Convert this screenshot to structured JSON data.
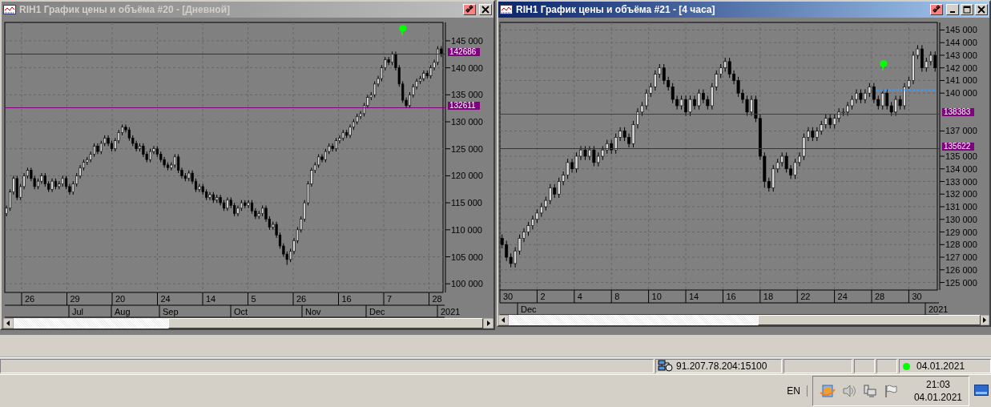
{
  "windows": [
    {
      "title": "RIH1 График цены и объёма #20 - [Дневной]",
      "active": false,
      "title_buttons": [
        {
          "kind": "link"
        },
        {
          "kind": "close"
        }
      ],
      "chart_data": {
        "type": "candlestick",
        "grid": true,
        "ylim": [
          98400,
          148400
        ],
        "yticks": [
          {
            "value": 145000,
            "label": "145 000"
          },
          {
            "value": 140000,
            "label": "140 000"
          },
          {
            "value": 135000,
            "label": "135 000"
          },
          {
            "value": 130000,
            "label": "130 000"
          },
          {
            "value": 125000,
            "label": "125 000"
          },
          {
            "value": 120000,
            "label": "120 000"
          },
          {
            "value": 115000,
            "label": "115 000"
          },
          {
            "value": 110000,
            "label": "110 000"
          },
          {
            "value": 105000,
            "label": "105 000"
          },
          {
            "value": 100000,
            "label": "100 000"
          }
        ],
        "ohlc": [
          [
            113000,
            114500,
            112500,
            114000
          ],
          [
            114000,
            117500,
            113500,
            117000
          ],
          [
            117000,
            120000,
            116500,
            119500
          ],
          [
            119500,
            120000,
            115500,
            116000
          ],
          [
            116000,
            118500,
            115500,
            118000
          ],
          [
            118000,
            120500,
            117500,
            120000
          ],
          [
            120000,
            121500,
            119500,
            121000
          ],
          [
            121000,
            121500,
            119000,
            119500
          ],
          [
            119500,
            120000,
            117500,
            118000
          ],
          [
            118000,
            119500,
            117500,
            119000
          ],
          [
            119000,
            120500,
            118500,
            120000
          ],
          [
            120000,
            120500,
            118000,
            118500
          ],
          [
            118500,
            119000,
            117000,
            117500
          ],
          [
            117500,
            119500,
            117000,
            119000
          ],
          [
            119000,
            119500,
            117500,
            118000
          ],
          [
            118000,
            119000,
            117500,
            118500
          ],
          [
            118500,
            120000,
            118000,
            119500
          ],
          [
            119500,
            120000,
            117500,
            118000
          ],
          [
            118000,
            118500,
            116500,
            117000
          ],
          [
            117000,
            119000,
            116500,
            118500
          ],
          [
            118500,
            120500,
            118000,
            120000
          ],
          [
            120000,
            122000,
            119500,
            121500
          ],
          [
            121500,
            123000,
            121000,
            122500
          ],
          [
            122500,
            123500,
            122000,
            123000
          ],
          [
            123000,
            124500,
            122500,
            124000
          ],
          [
            124000,
            126000,
            123500,
            125500
          ],
          [
            125500,
            126000,
            124000,
            124500
          ],
          [
            124500,
            126500,
            124000,
            126000
          ],
          [
            126000,
            127500,
            125500,
            127000
          ],
          [
            127000,
            127500,
            125500,
            126000
          ],
          [
            126000,
            126500,
            124500,
            125000
          ],
          [
            125000,
            127000,
            124500,
            126500
          ],
          [
            126500,
            128500,
            126000,
            128000
          ],
          [
            128000,
            129500,
            127500,
            129000
          ],
          [
            129000,
            129500,
            128000,
            128500
          ],
          [
            128500,
            129000,
            126500,
            127000
          ],
          [
            127000,
            127500,
            125500,
            126000
          ],
          [
            126000,
            126500,
            124500,
            125000
          ],
          [
            125000,
            126000,
            124500,
            125500
          ],
          [
            125500,
            126000,
            123500,
            124000
          ],
          [
            124000,
            124500,
            122500,
            123000
          ],
          [
            123000,
            125000,
            122500,
            124500
          ],
          [
            124500,
            125500,
            124000,
            125000
          ],
          [
            125000,
            125500,
            123500,
            124000
          ],
          [
            124000,
            124500,
            122500,
            123000
          ],
          [
            123000,
            123500,
            121500,
            122000
          ],
          [
            122000,
            122500,
            121000,
            121500
          ],
          [
            121500,
            122500,
            121000,
            122000
          ],
          [
            122000,
            124000,
            121500,
            123500
          ],
          [
            123500,
            124000,
            120500,
            121000
          ],
          [
            121000,
            121500,
            119500,
            120000
          ],
          [
            120000,
            120500,
            119000,
            119500
          ],
          [
            119500,
            121000,
            119000,
            120500
          ],
          [
            120500,
            121000,
            118500,
            119000
          ],
          [
            119000,
            119500,
            117000,
            117500
          ],
          [
            117500,
            118500,
            117000,
            118000
          ],
          [
            118000,
            118500,
            116500,
            117000
          ],
          [
            117000,
            117500,
            115500,
            116000
          ],
          [
            116000,
            117000,
            115500,
            116500
          ],
          [
            116500,
            117000,
            115000,
            115500
          ],
          [
            115500,
            116500,
            115000,
            116000
          ],
          [
            116000,
            116500,
            114500,
            115000
          ],
          [
            115000,
            115500,
            113500,
            114000
          ],
          [
            114000,
            116000,
            113500,
            115500
          ],
          [
            115500,
            116000,
            114000,
            114500
          ],
          [
            114500,
            115000,
            112500,
            113000
          ],
          [
            113000,
            114500,
            112500,
            114000
          ],
          [
            114000,
            115500,
            113500,
            115000
          ],
          [
            115000,
            115500,
            114000,
            114500
          ],
          [
            114500,
            115500,
            114000,
            115000
          ],
          [
            115000,
            115500,
            113000,
            113500
          ],
          [
            113500,
            114000,
            112000,
            112500
          ],
          [
            112500,
            113500,
            112000,
            113000
          ],
          [
            113000,
            114500,
            112500,
            114000
          ],
          [
            114000,
            114500,
            111500,
            112000
          ],
          [
            112000,
            112500,
            110000,
            110500
          ],
          [
            110500,
            111500,
            110000,
            111000
          ],
          [
            111000,
            111500,
            108500,
            109000
          ],
          [
            109000,
            109500,
            106500,
            107000
          ],
          [
            107000,
            107500,
            105000,
            105500
          ],
          [
            105500,
            106000,
            103500,
            104500
          ],
          [
            104500,
            106500,
            104000,
            106000
          ],
          [
            106000,
            108500,
            105500,
            108000
          ],
          [
            108000,
            110500,
            107500,
            110000
          ],
          [
            110000,
            112500,
            109500,
            112000
          ],
          [
            112000,
            115500,
            111500,
            115000
          ],
          [
            115000,
            119000,
            114500,
            118500
          ],
          [
            118500,
            121500,
            118000,
            121000
          ],
          [
            121000,
            122500,
            120500,
            122000
          ],
          [
            122000,
            124000,
            121500,
            123500
          ],
          [
            123500,
            124000,
            122500,
            123000
          ],
          [
            123000,
            125000,
            122500,
            124500
          ],
          [
            124500,
            126000,
            124000,
            125500
          ],
          [
            125500,
            126000,
            124500,
            125000
          ],
          [
            125000,
            127000,
            124500,
            126500
          ],
          [
            126500,
            127500,
            126000,
            127000
          ],
          [
            127000,
            128500,
            126500,
            128000
          ],
          [
            128000,
            128500,
            127000,
            127500
          ],
          [
            127500,
            129500,
            127000,
            129000
          ],
          [
            129000,
            130500,
            128500,
            130000
          ],
          [
            130000,
            131500,
            129500,
            131000
          ],
          [
            131000,
            132000,
            130500,
            131500
          ],
          [
            131500,
            133500,
            131000,
            133000
          ],
          [
            133000,
            135000,
            132500,
            134500
          ],
          [
            134500,
            135500,
            134000,
            135000
          ],
          [
            135000,
            137500,
            134500,
            137000
          ],
          [
            137000,
            138500,
            136500,
            138000
          ],
          [
            138000,
            140500,
            137500,
            140000
          ],
          [
            140000,
            142000,
            139500,
            141500
          ],
          [
            141500,
            142000,
            140500,
            141000
          ],
          [
            141000,
            143000,
            140500,
            142500
          ],
          [
            142500,
            143000,
            139500,
            140000
          ],
          [
            140000,
            140500,
            136500,
            137000
          ],
          [
            137000,
            137500,
            133500,
            134000
          ],
          [
            134000,
            134500,
            132500,
            133000
          ],
          [
            133000,
            135500,
            132500,
            135000
          ],
          [
            135000,
            137000,
            134500,
            136500
          ],
          [
            136500,
            138000,
            136000,
            137500
          ],
          [
            137500,
            138500,
            137000,
            138000
          ],
          [
            138000,
            139500,
            137500,
            139000
          ],
          [
            139000,
            139500,
            138000,
            138500
          ],
          [
            138500,
            140500,
            138000,
            140000
          ],
          [
            140000,
            141500,
            139500,
            141000
          ],
          [
            141000,
            144000,
            140500,
            143500
          ],
          [
            143500,
            144000,
            142000,
            142500
          ]
        ]
      },
      "levels": [
        {
          "tag": "142686",
          "color": "#800080"
        },
        {
          "tag": "132611",
          "color": "#800080"
        }
      ],
      "signal_marker": true,
      "day_labels": [
        "26",
        "29",
        "20",
        "24",
        "14",
        "5",
        "26",
        "16",
        "7",
        "28"
      ],
      "month_labels": [
        "Jul",
        "Aug",
        "Sep",
        "Oct",
        "Nov",
        "Dec",
        "2021"
      ]
    },
    {
      "title": "RIH1 График цены и объёма #21 - [4 часа]",
      "active": true,
      "title_buttons": [
        {
          "kind": "link"
        },
        {
          "kind": "minimize"
        },
        {
          "kind": "maximize"
        },
        {
          "kind": "close"
        }
      ],
      "chart_data": {
        "type": "candlestick",
        "grid": true,
        "ylim": [
          124400,
          145600
        ],
        "yticks": [
          {
            "value": 145000,
            "label": "145 000"
          },
          {
            "value": 144000,
            "label": "144 000"
          },
          {
            "value": 143000,
            "label": "143 000"
          },
          {
            "value": 142000,
            "label": "142 000"
          },
          {
            "value": 141000,
            "label": "141 000"
          },
          {
            "value": 140000,
            "label": "140 000"
          },
          {
            "value": 137000,
            "label": "137 000"
          },
          {
            "value": 135000,
            "label": "135 000"
          },
          {
            "value": 134000,
            "label": "134 000"
          },
          {
            "value": 133000,
            "label": "133 000"
          },
          {
            "value": 132000,
            "label": "132 000"
          },
          {
            "value": 131000,
            "label": "131 000"
          },
          {
            "value": 130000,
            "label": "130 000"
          },
          {
            "value": 129000,
            "label": "129 000"
          },
          {
            "value": 128000,
            "label": "128 000"
          },
          {
            "value": 127000,
            "label": "127 000"
          },
          {
            "value": 126000,
            "label": "126 000"
          },
          {
            "value": 125000,
            "label": "125 000"
          }
        ],
        "ohlc": [
          [
            128500,
            128800,
            127700,
            128000
          ],
          [
            128000,
            128300,
            126700,
            127000
          ],
          [
            127000,
            127300,
            126200,
            126500
          ],
          [
            126500,
            127800,
            126200,
            127500
          ],
          [
            127500,
            128800,
            127200,
            128500
          ],
          [
            128500,
            129300,
            128200,
            129000
          ],
          [
            129000,
            129800,
            128700,
            129500
          ],
          [
            129500,
            130300,
            129200,
            130000
          ],
          [
            130000,
            130800,
            129700,
            130500
          ],
          [
            130500,
            131300,
            130200,
            131000
          ],
          [
            131000,
            131800,
            130700,
            131500
          ],
          [
            131500,
            132800,
            131200,
            132500
          ],
          [
            132500,
            132800,
            131700,
            132000
          ],
          [
            132000,
            133300,
            131700,
            133000
          ],
          [
            133000,
            133800,
            132700,
            133500
          ],
          [
            133500,
            134800,
            133200,
            134500
          ],
          [
            134500,
            134800,
            133700,
            134000
          ],
          [
            134000,
            135300,
            133700,
            135000
          ],
          [
            135000,
            135800,
            134700,
            135500
          ],
          [
            135500,
            135800,
            134700,
            135000
          ],
          [
            135000,
            135800,
            134700,
            135500
          ],
          [
            135500,
            135800,
            134200,
            134500
          ],
          [
            134500,
            135300,
            134200,
            135000
          ],
          [
            135000,
            135800,
            134700,
            135500
          ],
          [
            135500,
            136300,
            135200,
            136000
          ],
          [
            136000,
            136300,
            135200,
            135500
          ],
          [
            135500,
            136800,
            135200,
            136500
          ],
          [
            136500,
            137300,
            136200,
            137000
          ],
          [
            137000,
            137300,
            136200,
            136500
          ],
          [
            136500,
            136800,
            135700,
            136000
          ],
          [
            136000,
            137800,
            135700,
            137500
          ],
          [
            137500,
            138800,
            137200,
            138500
          ],
          [
            138500,
            139300,
            138200,
            139000
          ],
          [
            139000,
            140300,
            138700,
            140000
          ],
          [
            140000,
            140800,
            139700,
            140500
          ],
          [
            140500,
            141800,
            140200,
            141500
          ],
          [
            141500,
            142300,
            141200,
            142000
          ],
          [
            142000,
            142300,
            140700,
            141000
          ],
          [
            141000,
            141300,
            140200,
            140500
          ],
          [
            140500,
            140800,
            139200,
            139500
          ],
          [
            139500,
            139800,
            138700,
            139000
          ],
          [
            139000,
            139800,
            138700,
            139500
          ],
          [
            139500,
            139800,
            138200,
            138500
          ],
          [
            138500,
            139800,
            138200,
            139500
          ],
          [
            139500,
            139800,
            138700,
            139000
          ],
          [
            139000,
            140300,
            138700,
            140000
          ],
          [
            140000,
            140300,
            139200,
            139500
          ],
          [
            139500,
            139800,
            138700,
            139000
          ],
          [
            139000,
            140800,
            138700,
            140500
          ],
          [
            140500,
            141800,
            140200,
            141500
          ],
          [
            141500,
            142300,
            141200,
            142000
          ],
          [
            142000,
            142800,
            141700,
            142500
          ],
          [
            142500,
            142800,
            141200,
            141500
          ],
          [
            141500,
            141800,
            140700,
            141000
          ],
          [
            141000,
            141300,
            139700,
            140000
          ],
          [
            140000,
            140300,
            139200,
            139500
          ],
          [
            139500,
            139800,
            138200,
            138500
          ],
          [
            138500,
            139800,
            138200,
            139500
          ],
          [
            139500,
            139800,
            137700,
            138000
          ],
          [
            138000,
            138300,
            134700,
            135000
          ],
          [
            135000,
            135300,
            132500,
            133000
          ],
          [
            133000,
            133300,
            132200,
            132500
          ],
          [
            132500,
            134300,
            132200,
            134000
          ],
          [
            134000,
            134800,
            133700,
            134500
          ],
          [
            134500,
            135300,
            134200,
            135000
          ],
          [
            135000,
            135300,
            133700,
            134000
          ],
          [
            134000,
            134300,
            133200,
            133500
          ],
          [
            133500,
            134800,
            133200,
            134500
          ],
          [
            134500,
            135300,
            134200,
            135000
          ],
          [
            135000,
            136800,
            134700,
            136500
          ],
          [
            136500,
            137300,
            136200,
            137000
          ],
          [
            137000,
            137300,
            136200,
            136500
          ],
          [
            136500,
            137300,
            136200,
            137000
          ],
          [
            137000,
            137800,
            136700,
            137500
          ],
          [
            137500,
            138300,
            137200,
            138000
          ],
          [
            138000,
            138300,
            137200,
            137500
          ],
          [
            137500,
            138300,
            137200,
            138000
          ],
          [
            138000,
            138800,
            137700,
            138500
          ],
          [
            138500,
            138800,
            138200,
            138500
          ],
          [
            138500,
            139300,
            138200,
            139000
          ],
          [
            139000,
            139800,
            138700,
            139500
          ],
          [
            139500,
            140300,
            139200,
            140000
          ],
          [
            140000,
            140300,
            139200,
            139500
          ],
          [
            139500,
            140300,
            139200,
            140000
          ],
          [
            140000,
            140800,
            139700,
            140500
          ],
          [
            140500,
            140800,
            139200,
            139500
          ],
          [
            139500,
            139800,
            138700,
            139000
          ],
          [
            139000,
            140300,
            138700,
            140000
          ],
          [
            140000,
            140300,
            138700,
            139000
          ],
          [
            139000,
            139300,
            138200,
            138500
          ],
          [
            138500,
            139800,
            138200,
            139500
          ],
          [
            139500,
            139800,
            138700,
            139000
          ],
          [
            139000,
            140800,
            138700,
            140500
          ],
          [
            140500,
            141300,
            140200,
            141000
          ],
          [
            141000,
            143300,
            140700,
            143000
          ],
          [
            143000,
            143800,
            142700,
            143500
          ],
          [
            143500,
            143800,
            141700,
            142000
          ],
          [
            142000,
            142800,
            141700,
            142500
          ],
          [
            142500,
            143300,
            142200,
            143000
          ],
          [
            143000,
            143300,
            141700,
            142000
          ]
        ]
      },
      "levels": [
        {
          "tag": "138383",
          "color": "#404040"
        },
        {
          "tag": "135622",
          "color": "#800080"
        }
      ],
      "signal_marker": true,
      "signal_line": true,
      "day_labels": [
        "30",
        "2",
        "4",
        "8",
        "10",
        "14",
        "16",
        "18",
        "22",
        "24",
        "28",
        "30"
      ],
      "month_labels": [
        "Dec",
        "2021"
      ]
    }
  ],
  "status_bar": {
    "cells": [
      {
        "kind": "empty"
      },
      {
        "kind": "connection",
        "text": "91.207.78.204:15100"
      },
      {
        "kind": "empty"
      },
      {
        "kind": "empty"
      },
      {
        "kind": "empty"
      },
      {
        "kind": "status",
        "text": "04.01.2021",
        "color": "#00ff00"
      }
    ]
  },
  "taskbar": {
    "language": "EN",
    "time": "21:03",
    "date": "04.01.2021"
  }
}
